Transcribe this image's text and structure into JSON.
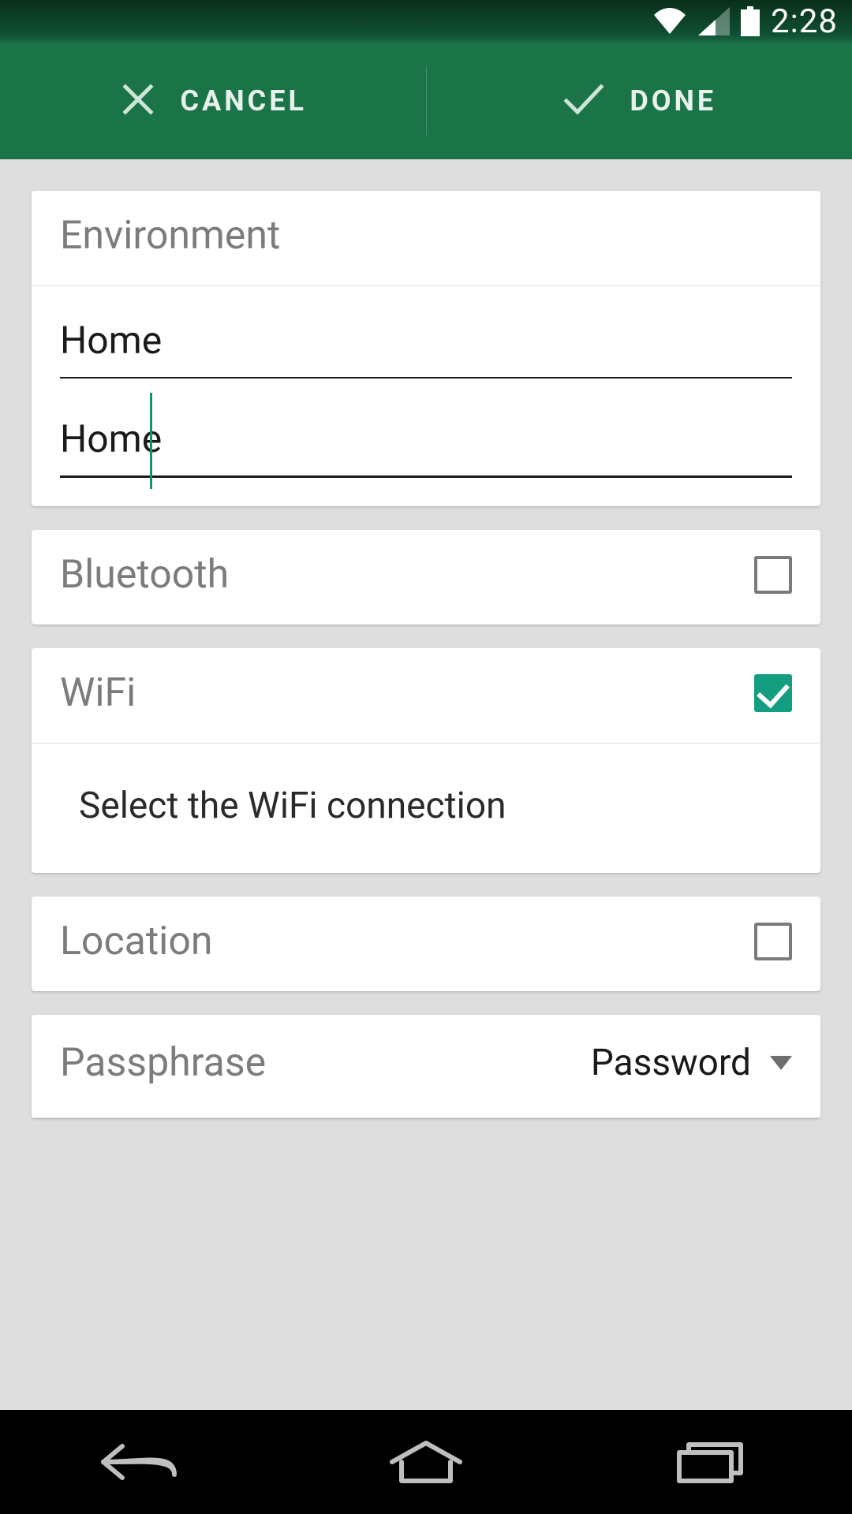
{
  "status_bar": {
    "time": "2:28"
  },
  "action_bar": {
    "cancel_label": "CANCEL",
    "done_label": "DONE"
  },
  "environment_card": {
    "title": "Environment",
    "name_value": "Home",
    "desc_value": "Home"
  },
  "bluetooth_card": {
    "title": "Bluetooth",
    "checked": false
  },
  "wifi_card": {
    "title": "WiFi",
    "checked": true,
    "select_label": "Select the WiFi connection"
  },
  "location_card": {
    "title": "Location",
    "checked": false
  },
  "passphrase_card": {
    "title": "Passphrase",
    "dropdown_value": "Password"
  }
}
